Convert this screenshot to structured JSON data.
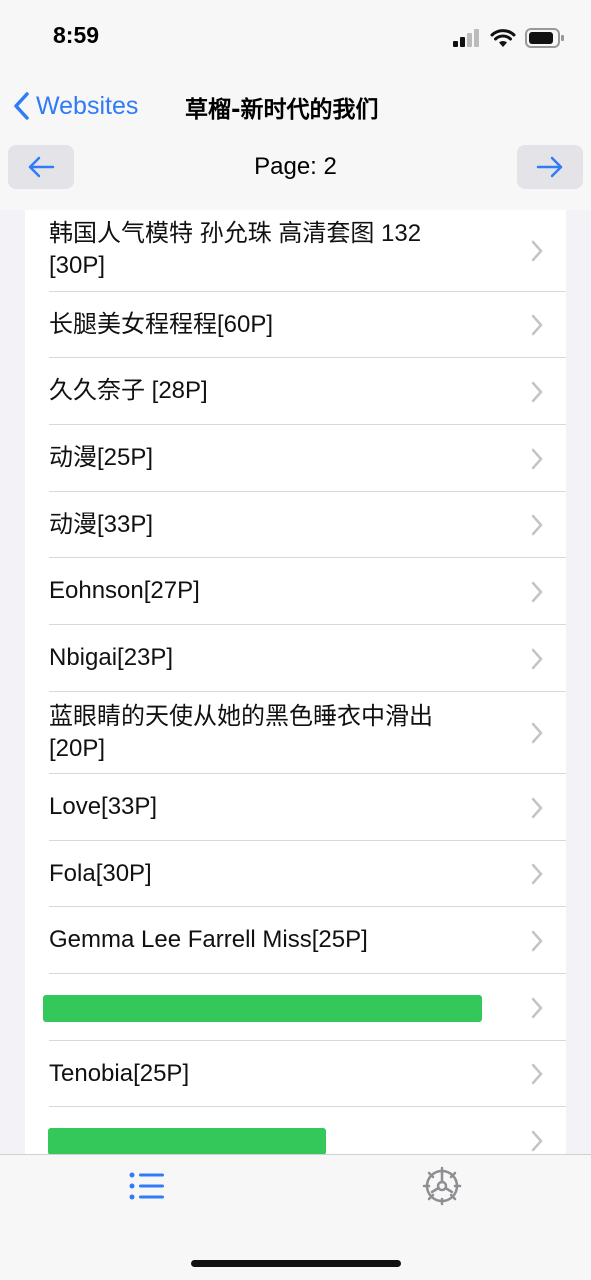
{
  "status": {
    "time": "8:59"
  },
  "nav": {
    "back_label": "Websites",
    "title": "草榴-新时代的我们"
  },
  "pager": {
    "label": "Page: 2"
  },
  "list": {
    "items": [
      {
        "title": "韩国人气模特  孙允珠  高清套图 132\n[30P]"
      },
      {
        "title": "长腿美女程程程[60P]"
      },
      {
        "title": "久久奈子 [28P]"
      },
      {
        "title": "动漫[25P]"
      },
      {
        "title": "动漫[33P]"
      },
      {
        "title": "Eohnson[27P]"
      },
      {
        "title": "Nbigai[23P]"
      },
      {
        "title": "蓝眼睛的天使从她的黑色睡衣中滑出\n[20P]"
      },
      {
        "title": "Love[33P]"
      },
      {
        "title": "Fola[30P]"
      },
      {
        "title": "Gemma Lee Farrell Miss[25P]"
      },
      {
        "title": ""
      },
      {
        "title": "Tenobia[25P]"
      },
      {
        "title": ""
      }
    ]
  },
  "tabs": [
    {
      "icon": "list-icon",
      "active": true
    },
    {
      "icon": "gear-icon",
      "active": false
    }
  ],
  "colors": {
    "accent": "#2f7cf6",
    "redaction": "#34c759",
    "chevron": "#c4c4c7"
  }
}
